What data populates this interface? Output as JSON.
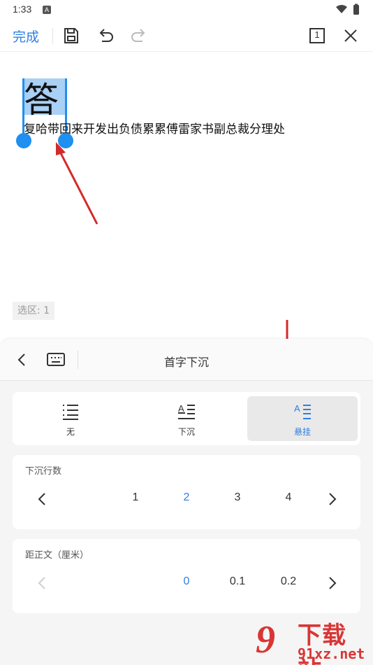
{
  "status": {
    "time": "1:33",
    "notification_letter": "A"
  },
  "toolbar": {
    "done_label": "完成",
    "page_indicator": "1"
  },
  "document": {
    "drop_cap_char": "答",
    "body_text": "复哈带回来开发出负债累累傅雷家书副总裁分理处",
    "selection_count": "选区: 1"
  },
  "panel": {
    "title": "首字下沉",
    "style_options": [
      {
        "label": "无",
        "icon": "no-drop-cap-icon",
        "active": false
      },
      {
        "label": "下沉",
        "icon": "drop-cap-icon",
        "active": false
      },
      {
        "label": "悬挂",
        "icon": "hanging-cap-icon",
        "active": true
      }
    ],
    "lines": {
      "title": "下沉行数",
      "values": [
        "1",
        "2",
        "3",
        "4"
      ],
      "selected": "2"
    },
    "distance": {
      "title": "距正文（厘米）",
      "values": [
        "0",
        "0.1",
        "0.2"
      ],
      "selected": "0"
    }
  },
  "watermark": {
    "brand": "下载站",
    "domain": "91xz.net"
  },
  "colors": {
    "accent": "#2f7fe0",
    "selection": "#a9d0f5",
    "annotation_arrow": "#d42a2a"
  }
}
